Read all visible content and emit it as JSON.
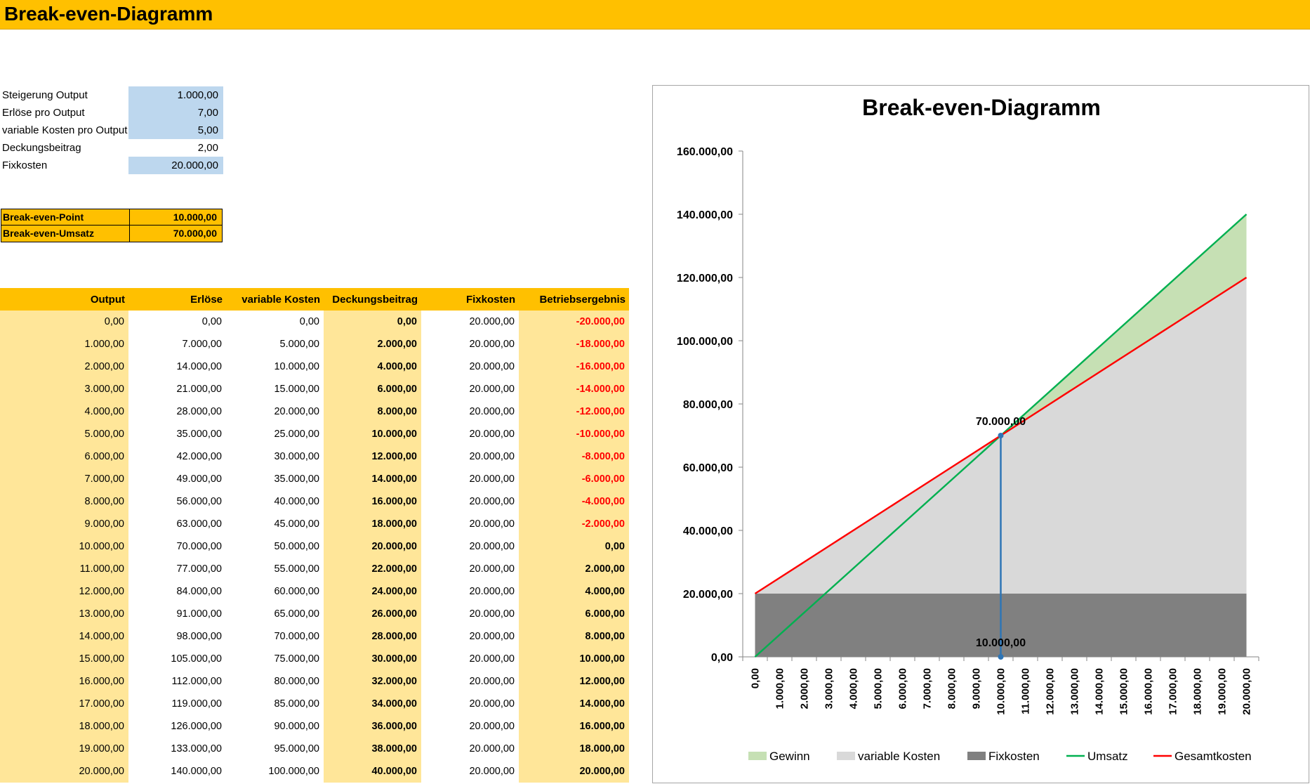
{
  "sheet_title": "Break-even-Diagramm",
  "params": [
    {
      "label": "Steigerung Output",
      "value": "1.000,00",
      "input": true
    },
    {
      "label": "Erlöse pro Output",
      "value": "7,00",
      "input": true
    },
    {
      "label": "variable Kosten pro Output",
      "value": "5,00",
      "input": true
    },
    {
      "label": "Deckungsbeitrag",
      "value": "2,00",
      "input": false
    },
    {
      "label": "Fixkosten",
      "value": "20.000,00",
      "input": true
    }
  ],
  "break_even": [
    {
      "label": "Break-even-Point",
      "value": "10.000,00"
    },
    {
      "label": "Break-even-Umsatz",
      "value": "70.000,00"
    }
  ],
  "table": {
    "headers": [
      "Output",
      "Erlöse",
      "variable Kosten",
      "Deckungsbeitrag",
      "Fixkosten",
      "Betriebsergebnis"
    ],
    "rows": [
      [
        "0,00",
        "0,00",
        "0,00",
        "0,00",
        "20.000,00",
        "-20.000,00"
      ],
      [
        "1.000,00",
        "7.000,00",
        "5.000,00",
        "2.000,00",
        "20.000,00",
        "-18.000,00"
      ],
      [
        "2.000,00",
        "14.000,00",
        "10.000,00",
        "4.000,00",
        "20.000,00",
        "-16.000,00"
      ],
      [
        "3.000,00",
        "21.000,00",
        "15.000,00",
        "6.000,00",
        "20.000,00",
        "-14.000,00"
      ],
      [
        "4.000,00",
        "28.000,00",
        "20.000,00",
        "8.000,00",
        "20.000,00",
        "-12.000,00"
      ],
      [
        "5.000,00",
        "35.000,00",
        "25.000,00",
        "10.000,00",
        "20.000,00",
        "-10.000,00"
      ],
      [
        "6.000,00",
        "42.000,00",
        "30.000,00",
        "12.000,00",
        "20.000,00",
        "-8.000,00"
      ],
      [
        "7.000,00",
        "49.000,00",
        "35.000,00",
        "14.000,00",
        "20.000,00",
        "-6.000,00"
      ],
      [
        "8.000,00",
        "56.000,00",
        "40.000,00",
        "16.000,00",
        "20.000,00",
        "-4.000,00"
      ],
      [
        "9.000,00",
        "63.000,00",
        "45.000,00",
        "18.000,00",
        "20.000,00",
        "-2.000,00"
      ],
      [
        "10.000,00",
        "70.000,00",
        "50.000,00",
        "20.000,00",
        "20.000,00",
        "0,00"
      ],
      [
        "11.000,00",
        "77.000,00",
        "55.000,00",
        "22.000,00",
        "20.000,00",
        "2.000,00"
      ],
      [
        "12.000,00",
        "84.000,00",
        "60.000,00",
        "24.000,00",
        "20.000,00",
        "4.000,00"
      ],
      [
        "13.000,00",
        "91.000,00",
        "65.000,00",
        "26.000,00",
        "20.000,00",
        "6.000,00"
      ],
      [
        "14.000,00",
        "98.000,00",
        "70.000,00",
        "28.000,00",
        "20.000,00",
        "8.000,00"
      ],
      [
        "15.000,00",
        "105.000,00",
        "75.000,00",
        "30.000,00",
        "20.000,00",
        "10.000,00"
      ],
      [
        "16.000,00",
        "112.000,00",
        "80.000,00",
        "32.000,00",
        "20.000,00",
        "12.000,00"
      ],
      [
        "17.000,00",
        "119.000,00",
        "85.000,00",
        "34.000,00",
        "20.000,00",
        "14.000,00"
      ],
      [
        "18.000,00",
        "126.000,00",
        "90.000,00",
        "36.000,00",
        "20.000,00",
        "16.000,00"
      ],
      [
        "19.000,00",
        "133.000,00",
        "95.000,00",
        "38.000,00",
        "20.000,00",
        "18.000,00"
      ],
      [
        "20.000,00",
        "140.000,00",
        "100.000,00",
        "40.000,00",
        "20.000,00",
        "20.000,00"
      ]
    ]
  },
  "colors": {
    "header_orange": "#ffc000",
    "column_shade": "#ffe699",
    "input_blue": "#bdd7ee",
    "negative_red": "#ff0000",
    "gewinn_fill": "#c6e0b4",
    "variable_fill": "#d9d9d9",
    "fix_fill": "#808080",
    "umsatz_line": "#00b050",
    "gesamt_line": "#ff0000",
    "be_marker": "#2e75b6"
  },
  "chart_data": {
    "type": "area",
    "title": "Break-even-Diagramm",
    "x": [
      0,
      1000,
      2000,
      3000,
      4000,
      5000,
      6000,
      7000,
      8000,
      9000,
      10000,
      11000,
      12000,
      13000,
      14000,
      15000,
      16000,
      17000,
      18000,
      19000,
      20000
    ],
    "x_tick_labels": [
      "0,00",
      "1.000,00",
      "2.000,00",
      "3.000,00",
      "4.000,00",
      "5.000,00",
      "6.000,00",
      "7.000,00",
      "8.000,00",
      "9.000,00",
      "10.000,00",
      "11.000,00",
      "12.000,00",
      "13.000,00",
      "14.000,00",
      "15.000,00",
      "16.000,00",
      "17.000,00",
      "18.000,00",
      "19.000,00",
      "20.000,00"
    ],
    "y_tick_labels": [
      "0,00",
      "20.000,00",
      "40.000,00",
      "60.000,00",
      "80.000,00",
      "100.000,00",
      "120.000,00",
      "140.000,00",
      "160.000,00"
    ],
    "ylim": [
      0,
      160000
    ],
    "series": [
      {
        "name": "Gewinn",
        "kind": "area",
        "values": [
          0,
          0,
          0,
          0,
          0,
          0,
          0,
          0,
          0,
          0,
          0,
          2000,
          4000,
          6000,
          8000,
          10000,
          12000,
          14000,
          16000,
          18000,
          20000
        ]
      },
      {
        "name": "variable Kosten",
        "kind": "area",
        "values": [
          0,
          5000,
          10000,
          15000,
          20000,
          25000,
          30000,
          35000,
          40000,
          45000,
          50000,
          55000,
          60000,
          65000,
          70000,
          75000,
          80000,
          85000,
          90000,
          95000,
          100000
        ]
      },
      {
        "name": "Fixkosten",
        "kind": "area",
        "values": [
          20000,
          20000,
          20000,
          20000,
          20000,
          20000,
          20000,
          20000,
          20000,
          20000,
          20000,
          20000,
          20000,
          20000,
          20000,
          20000,
          20000,
          20000,
          20000,
          20000,
          20000
        ]
      },
      {
        "name": "Umsatz",
        "kind": "line",
        "values": [
          0,
          7000,
          14000,
          21000,
          28000,
          35000,
          42000,
          49000,
          56000,
          63000,
          70000,
          77000,
          84000,
          91000,
          98000,
          105000,
          112000,
          119000,
          126000,
          133000,
          140000
        ]
      },
      {
        "name": "Gesamtkosten",
        "kind": "line",
        "values": [
          20000,
          25000,
          30000,
          35000,
          40000,
          45000,
          50000,
          55000,
          60000,
          65000,
          70000,
          75000,
          80000,
          85000,
          90000,
          95000,
          100000,
          105000,
          110000,
          115000,
          120000
        ]
      }
    ],
    "break_even_marker": {
      "x": 10000,
      "y": 70000,
      "label_top": "70.000,00",
      "label_bottom": "10.000,00"
    },
    "grid": false,
    "legend": "bottom"
  }
}
